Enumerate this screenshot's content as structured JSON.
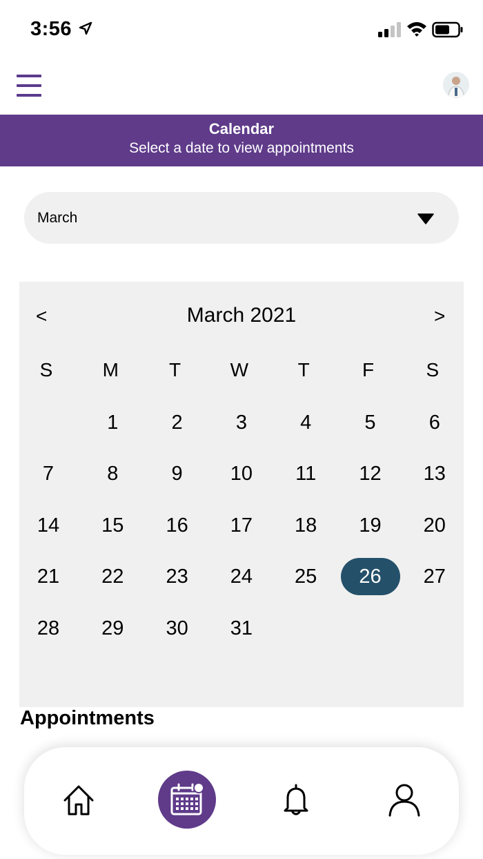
{
  "status_bar": {
    "time": "3:56"
  },
  "header": {
    "title": "Calendar",
    "subtitle": "Select a date to view appointments"
  },
  "month_select": {
    "value": "March"
  },
  "calendar": {
    "title": "March 2021",
    "prev_label": "<",
    "next_label": ">",
    "weekdays": [
      "S",
      "M",
      "T",
      "W",
      "T",
      "F",
      "S"
    ],
    "weeks": [
      [
        "",
        "1",
        "2",
        "3",
        "4",
        "5",
        "6"
      ],
      [
        "7",
        "8",
        "9",
        "10",
        "11",
        "12",
        "13"
      ],
      [
        "14",
        "15",
        "16",
        "17",
        "18",
        "19",
        "20"
      ],
      [
        "21",
        "22",
        "23",
        "24",
        "25",
        "26",
        "27"
      ],
      [
        "28",
        "29",
        "30",
        "31",
        "",
        "",
        ""
      ]
    ],
    "selected_day": "26"
  },
  "appointments": {
    "heading": "Appointments"
  },
  "nav": {
    "items": [
      "home-icon",
      "calendar-icon",
      "bell-icon",
      "profile-icon"
    ],
    "active": "calendar-icon"
  },
  "colors": {
    "brand_purple": "#5f3b8a",
    "selected_day": "#24506a",
    "calendar_bg": "#f0f0f0"
  }
}
